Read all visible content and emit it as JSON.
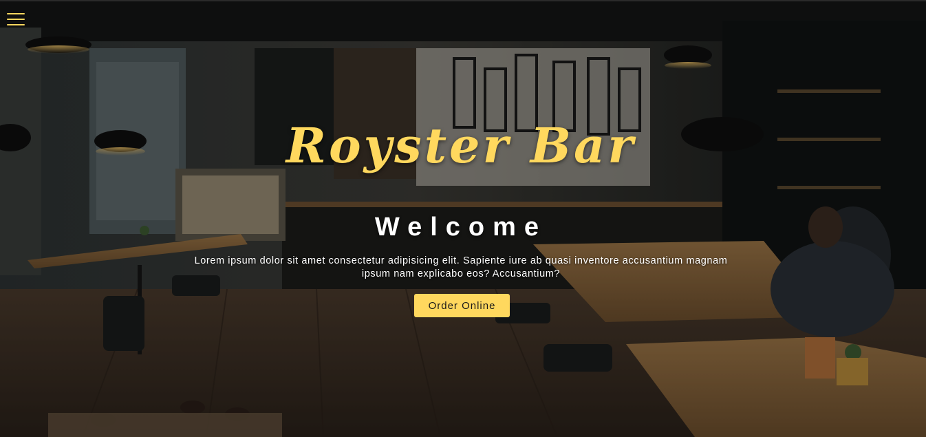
{
  "page": {
    "title": "Royster Bar",
    "subtitle": "Welcome",
    "description": "Lorem ipsum dolor sit amet consectetur adipisicing elit. Sapiente iure ab quasi inventore accusantium magnam ipsum nam explicabo eos? Accusantium?",
    "cta_label": "Order Online"
  },
  "nav": {
    "menu_icon": "hamburger-menu-icon"
  },
  "colors": {
    "accent": "#ffd85e",
    "text": "#ffffff",
    "overlay": "rgba(0,0,0,0.28)"
  }
}
